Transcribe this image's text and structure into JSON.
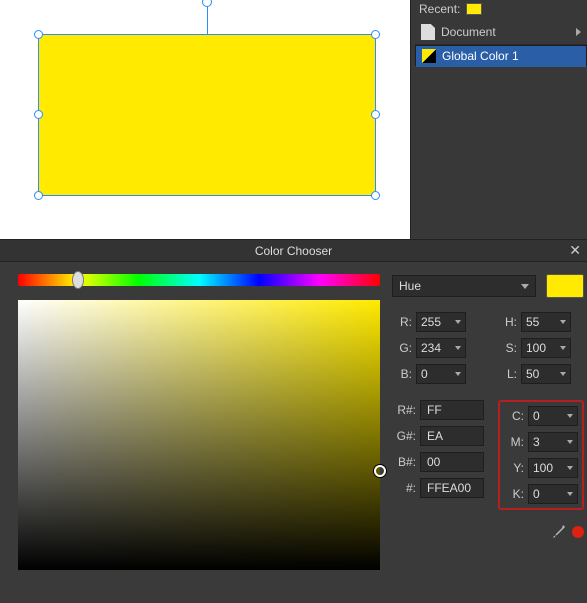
{
  "side": {
    "recent_label": "Recent:",
    "document_label": "Document",
    "global_color_label": "Global Color 1"
  },
  "chooser": {
    "title": "Color Chooser",
    "mode": "Hue",
    "preview_hex": "#ffea00"
  },
  "rgb": {
    "r_label": "R:",
    "g_label": "G:",
    "b_label": "B:",
    "r": "255",
    "g": "234",
    "b": "0"
  },
  "hsl": {
    "h_label": "H:",
    "s_label": "S:",
    "l_label": "L:",
    "h": "55",
    "s": "100",
    "l": "50"
  },
  "hex": {
    "r_label": "R#:",
    "g_label": "G#:",
    "b_label": "B#:",
    "full_label": "#:",
    "r": "FF",
    "g": "EA",
    "b": "00",
    "full": "FFEA00"
  },
  "cmyk": {
    "c_label": "C:",
    "m_label": "M:",
    "y_label": "Y:",
    "k_label": "K:",
    "c": "0",
    "m": "3",
    "y": "100",
    "k": "0"
  }
}
